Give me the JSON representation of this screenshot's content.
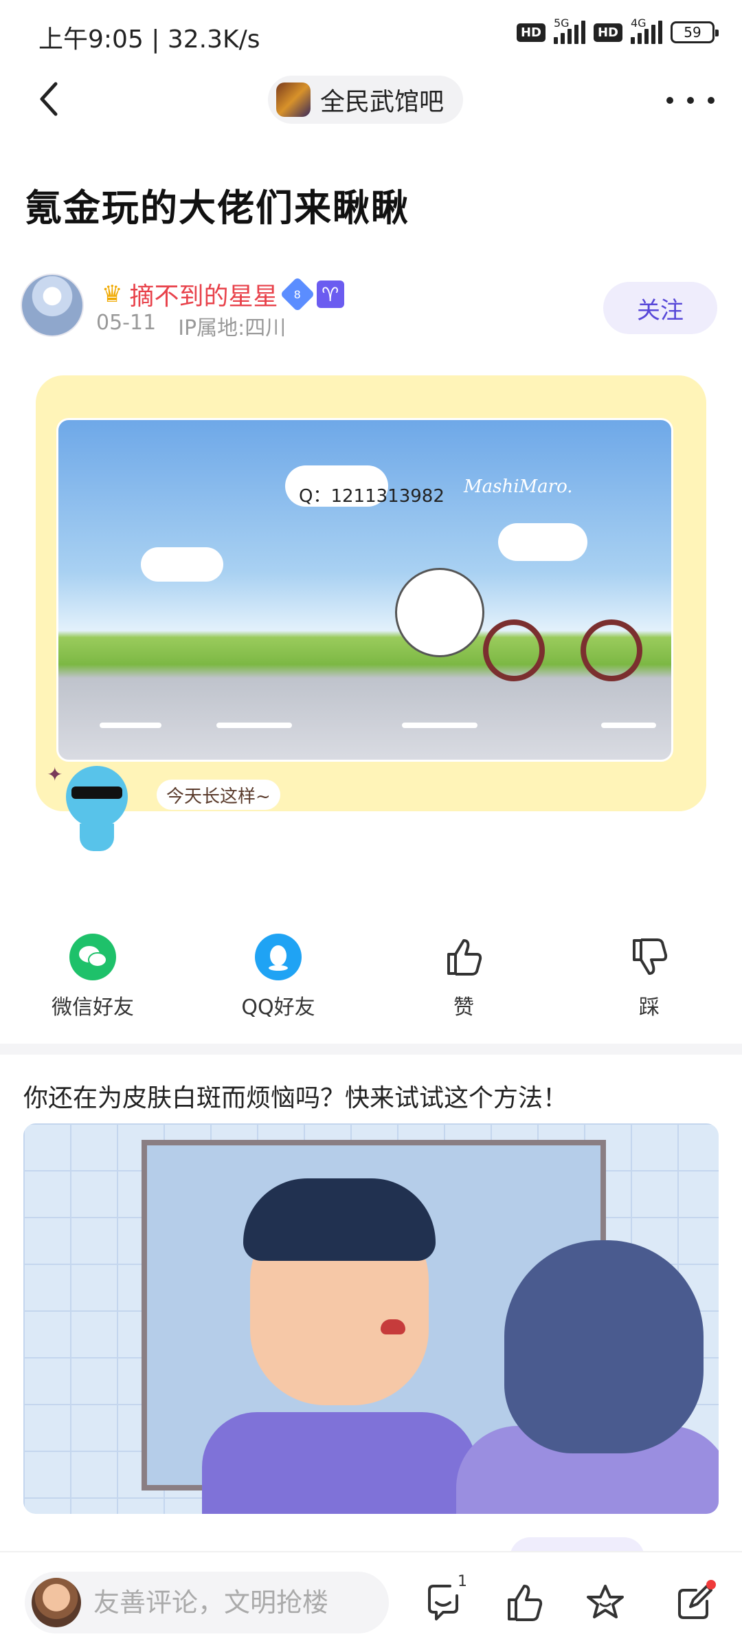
{
  "status_bar": {
    "time_speed": "上午9:05 | 32.3K/s",
    "hd1": "HD",
    "net1": "5G",
    "hd2": "HD",
    "net2": "4G",
    "battery": "59"
  },
  "top_nav": {
    "forum_name": "全民武馆吧"
  },
  "post": {
    "title": "氪金玩的大佬们来瞅瞅",
    "author": {
      "name": "摘不到的星星",
      "level": "8",
      "zodiac_symbol": "♈",
      "date": "05-11",
      "ip_location": "IP属地:四川",
      "follow_label": "关注"
    },
    "image": {
      "caption_qq": "Q：1211313982",
      "brand_script": "MashiMaro."
    },
    "sticker_caption": "今天长这样~"
  },
  "actions": {
    "wechat_label": "微信好友",
    "qq_label": "QQ好友",
    "like_label": "赞",
    "dislike_label": "踩"
  },
  "ad": {
    "title": "你还在为皮肤白斑而烦恼吗？快来试试这个方法！"
  },
  "bottom_bar": {
    "comment_placeholder": "友善评论，文明抢楼",
    "comment_count": "1"
  },
  "colors": {
    "accent": "#5747d8",
    "author_name": "#e8414a",
    "image_frame": "#fff4b8",
    "wechat": "#1ec16a",
    "qq": "#1fa3f4"
  }
}
